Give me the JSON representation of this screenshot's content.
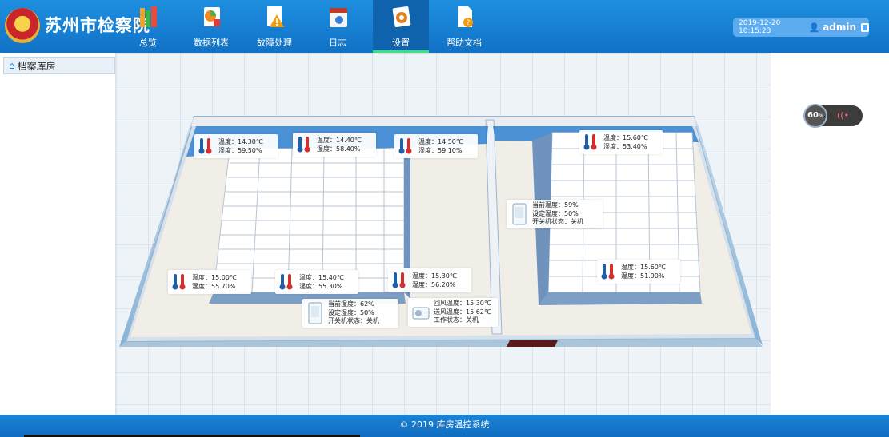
{
  "app": {
    "brand": "苏州市检察院"
  },
  "nav": [
    {
      "label": "总览",
      "icon": "books-icon"
    },
    {
      "label": "数据列表",
      "icon": "data-report-icon"
    },
    {
      "label": "故障处理",
      "icon": "warning-icon"
    },
    {
      "label": "日志",
      "icon": "calendar-icon"
    },
    {
      "label": "设置",
      "icon": "settings-gear-icon",
      "active": true
    },
    {
      "label": "帮助文档",
      "icon": "help-document-icon"
    }
  ],
  "user": {
    "datetime": "2019-12-20 10:15:23",
    "name": "admin"
  },
  "sidebar": {
    "items": [
      {
        "label": "档案库房"
      }
    ]
  },
  "widget": {
    "percent": "60",
    "percent_unit": "%"
  },
  "sensors": [
    {
      "temp": "温度：14.30℃",
      "hum": "湿度：59.50%"
    },
    {
      "temp": "温度：14.40℃",
      "hum": "湿度：58.40%"
    },
    {
      "temp": "温度：14.50℃",
      "hum": "湿度：59.10%"
    },
    {
      "temp": "温度：15.60℃",
      "hum": "湿度：53.40%"
    },
    {
      "temp": "温度：15.00℃",
      "hum": "湿度：55.70%"
    },
    {
      "temp": "温度：15.40℃",
      "hum": "湿度：55.30%"
    },
    {
      "temp": "温度：15.30℃",
      "hum": "湿度：56.20%"
    },
    {
      "temp": "温度：15.60℃",
      "hum": "湿度：51.90%"
    }
  ],
  "devices": [
    {
      "l1": "当前湿度：59%",
      "l2": "设定湿度：50%",
      "l3": "开关机状态：关机"
    },
    {
      "l1": "当前湿度：62%",
      "l2": "设定湿度：50%",
      "l3": "开关机状态：关机"
    },
    {
      "l1": "回风温度：15.30℃",
      "l2": "送风温度：15.62℃",
      "l3": "工作状态：关机"
    }
  ],
  "footer": {
    "text": "© 2019  库房温控系统"
  },
  "colors": {
    "header": "#1172c6",
    "accent": "#3ee07a",
    "footer": "#0f6cc0"
  }
}
